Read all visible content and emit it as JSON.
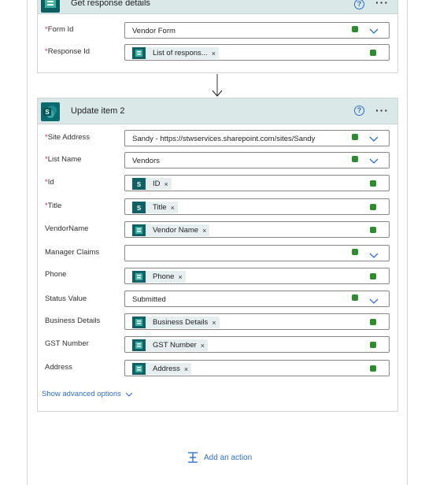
{
  "card1": {
    "title": "Get response details",
    "fields": [
      {
        "label": "Form Id",
        "required": "*",
        "value": "Vendor Form"
      },
      {
        "label": "Response Id",
        "required": "*",
        "token": "List of respons...",
        "token_remove": "×"
      }
    ]
  },
  "card2": {
    "title": "Update item 2",
    "help_glyph": "?",
    "more_glyph": "···",
    "fields": [
      {
        "label": "Site Address",
        "required": "*",
        "value": "Sandy - https://stwservices.sharepoint.com/sites/Sandy"
      },
      {
        "label": "List Name",
        "required": "*",
        "value": "Vendors"
      },
      {
        "label": "Id",
        "required": "*",
        "token": "ID",
        "token_remove": "×"
      },
      {
        "label": "Title",
        "required": "*",
        "token": "Title",
        "token_remove": "×"
      },
      {
        "label": "VendorName",
        "required": "",
        "token": "Vendor Name",
        "token_remove": "×"
      },
      {
        "label": "Manager Claims",
        "required": "",
        "value": ""
      },
      {
        "label": "Phone",
        "required": "",
        "token": "Phone",
        "token_remove": "×"
      },
      {
        "label": "Status Value",
        "required": "",
        "value": "Submitted"
      },
      {
        "label": "Business Details",
        "required": "",
        "token": "Business Details",
        "token_remove": "×"
      },
      {
        "label": "GST Number",
        "required": "",
        "token": "GST Number",
        "token_remove": "×"
      },
      {
        "label": "Address",
        "required": "",
        "token": "Address",
        "token_remove": "×"
      }
    ],
    "advanced_options": "Show advanced options"
  },
  "add_action": {
    "label": "Add an action"
  },
  "colors": {
    "accent": "#2f6fd0",
    "header_bg": "#dbe8e8",
    "token_icon": "#0f6165",
    "required": "#c4314b",
    "status_dot": "#2e8b2e"
  },
  "icons": {
    "sharepoint": "sharepoint-icon",
    "forms": "forms-icon",
    "chevron": "chevron-down-icon",
    "help": "help-icon",
    "more": "more-options-icon",
    "add": "add-action-icon"
  }
}
